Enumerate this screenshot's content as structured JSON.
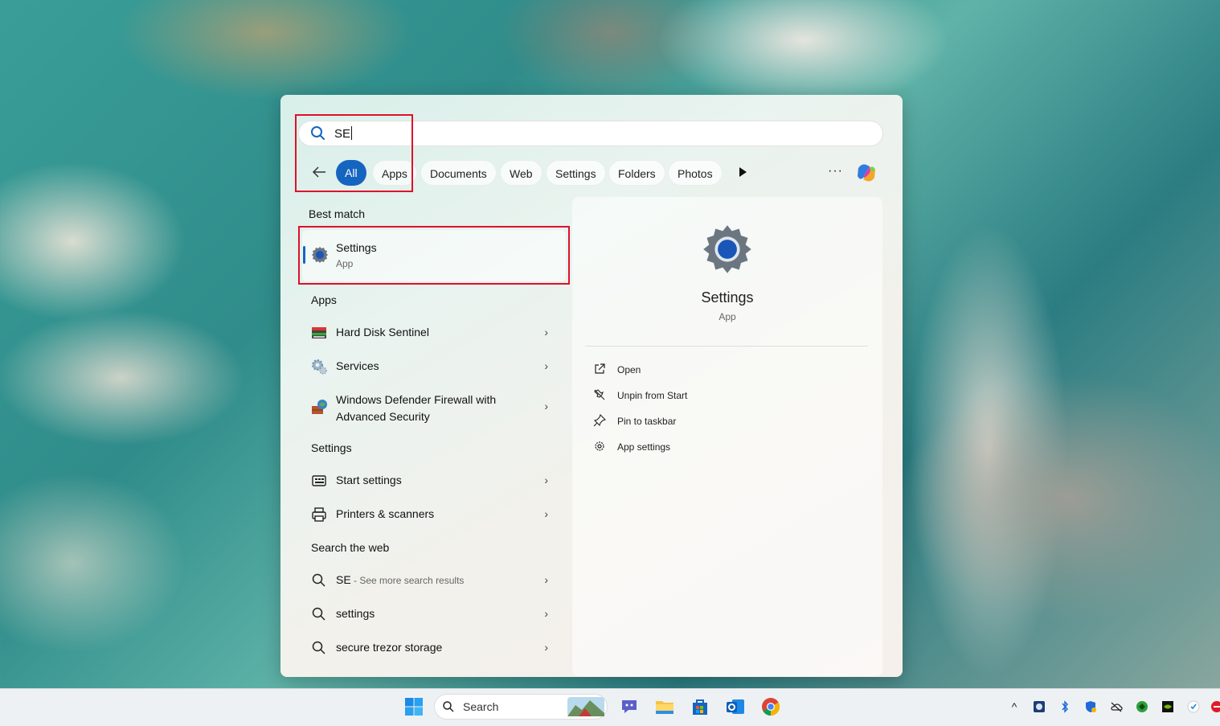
{
  "search": {
    "query": "SE"
  },
  "filters": [
    "All",
    "Apps",
    "Documents",
    "Web",
    "Settings",
    "Folders",
    "Photos"
  ],
  "sections": {
    "best_match": "Best match",
    "apps": "Apps",
    "settings": "Settings",
    "web": "Search the web"
  },
  "best_match": {
    "title": "Settings",
    "subtitle": "App"
  },
  "apps": [
    {
      "label": "Hard Disk Sentinel",
      "icon": "hard-disk-sentinel-icon"
    },
    {
      "label": "Services",
      "icon": "services-gear-icon"
    },
    {
      "label": "Windows Defender Firewall with",
      "label2": "Advanced Security",
      "icon": "firewall-icon"
    }
  ],
  "settings_items": [
    {
      "label": "Start settings",
      "icon": "start-settings-icon"
    },
    {
      "label": "Printers & scanners",
      "icon": "printer-icon"
    }
  ],
  "web_items": [
    {
      "label": "SE",
      "hint": " - See more search results"
    },
    {
      "label": "settings"
    },
    {
      "label": "secure trezor storage"
    }
  ],
  "detail": {
    "title": "Settings",
    "subtitle": "App",
    "actions": [
      "Open",
      "Unpin from Start",
      "Pin to taskbar",
      "App settings"
    ]
  },
  "taskbar": {
    "search_placeholder": "Search"
  },
  "colors": {
    "accent": "#1565c0",
    "highlight": "#e0102a"
  }
}
